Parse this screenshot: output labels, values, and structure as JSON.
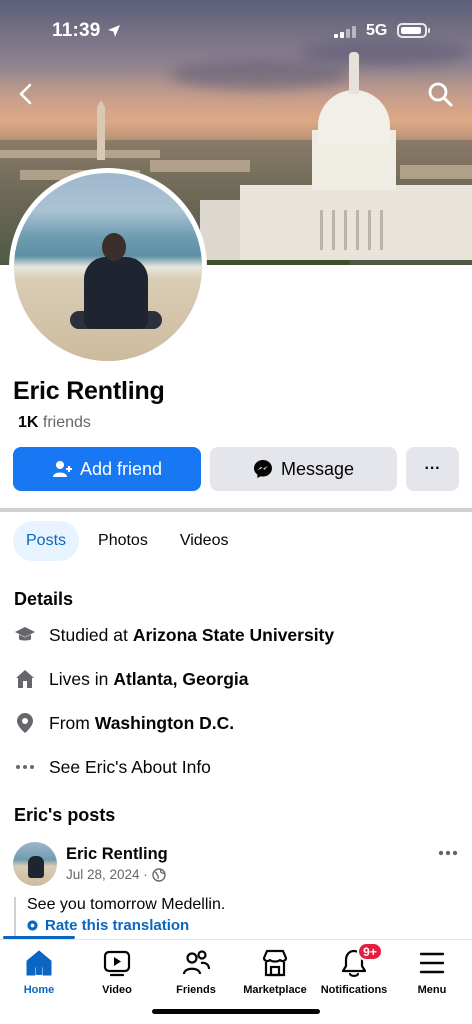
{
  "status": {
    "time": "11:39",
    "network": "5G"
  },
  "profile": {
    "name": "Eric Rentling",
    "friends_count": "1K",
    "friends_label": "friends"
  },
  "actions": {
    "add_friend": "Add friend",
    "message": "Message",
    "more": "···"
  },
  "tabs": [
    {
      "label": "Posts",
      "active": true
    },
    {
      "label": "Photos",
      "active": false
    },
    {
      "label": "Videos",
      "active": false
    }
  ],
  "details": {
    "title": "Details",
    "items": [
      {
        "icon": "graduation-cap-icon",
        "prefix": "Studied at",
        "value": "Arizona State University"
      },
      {
        "icon": "home-icon",
        "prefix": "Lives in",
        "value": "Atlanta, Georgia"
      },
      {
        "icon": "location-pin-icon",
        "prefix": "From",
        "value": "Washington D.C."
      },
      {
        "icon": "more-dots-icon",
        "prefix": "See Eric's About Info",
        "value": ""
      }
    ]
  },
  "posts": {
    "title": "Eric's posts",
    "author": "Eric Rentling",
    "date": "Jul 28, 2024 ·",
    "text": "See you tomorrow Medellin.",
    "rate_translation": "Rate this translation"
  },
  "nav": {
    "items": [
      {
        "label": "Home",
        "icon": "home-icon",
        "active": true
      },
      {
        "label": "Video",
        "icon": "video-icon",
        "active": false
      },
      {
        "label": "Friends",
        "icon": "friends-icon",
        "active": false
      },
      {
        "label": "Marketplace",
        "icon": "marketplace-icon",
        "active": false
      },
      {
        "label": "Notifications",
        "icon": "bell-icon",
        "active": false
      },
      {
        "label": "Menu",
        "icon": "menu-icon",
        "active": false
      }
    ],
    "notifications_badge": "9+"
  },
  "colors": {
    "accent": "#1877f2",
    "link": "#0a66c2",
    "secondary_button": "#e4e6eb",
    "badge": "#e41e3f"
  }
}
